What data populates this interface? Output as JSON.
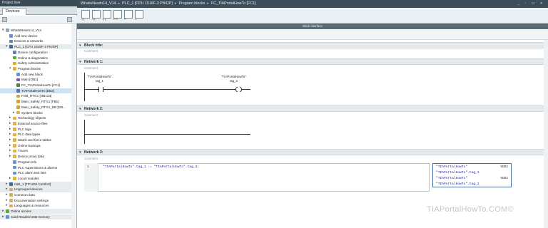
{
  "left_panel": {
    "title": "Project tree",
    "tab": "Devices",
    "tree": [
      {
        "label": "WhatisNewIn14_V14",
        "indent": 0,
        "icon_color": "#8aa7c0",
        "twisty": "▾"
      },
      {
        "label": "Add new device",
        "indent": 1,
        "icon_color": "#6a93c9",
        "twisty": ""
      },
      {
        "label": "Devices & networks",
        "indent": 1,
        "icon_color": "#5b86b8",
        "twisty": ""
      },
      {
        "label": "PLC_1 [CPU 1516F-3 PN/DP]",
        "indent": 1,
        "icon_color": "#3d6b9c",
        "twisty": "▾",
        "style": "grp"
      },
      {
        "label": "Device configuration",
        "indent": 2,
        "icon_color": "#5b86b8",
        "twisty": ""
      },
      {
        "label": "Online & diagnostics",
        "indent": 2,
        "icon_color": "#6aa04a",
        "twisty": ""
      },
      {
        "label": "Safety Administration",
        "indent": 2,
        "icon_color": "#e0b020",
        "twisty": ""
      },
      {
        "label": "Program blocks",
        "indent": 2,
        "icon_color": "#d9b24a",
        "twisty": "▾"
      },
      {
        "label": "Add new block",
        "indent": 3,
        "icon_color": "#6a93c9",
        "twisty": ""
      },
      {
        "label": "Main [OB1]",
        "indent": 3,
        "icon_color": "#8a4fb5",
        "twisty": ""
      },
      {
        "label": "FC_TIAPortalHowTo [FC1]",
        "indent": 3,
        "icon_color": "#3f8f3f",
        "twisty": ""
      },
      {
        "label": "TIAPortalHowTo [DB2]",
        "indent": 3,
        "icon_color": "#4f79b0",
        "twisty": "",
        "style": "sel"
      },
      {
        "label": "FOB_RTG1 [OB123]",
        "indent": 3,
        "icon_color": "#d9a02b",
        "twisty": ""
      },
      {
        "label": "Main_Safety_RTG1 [FB1]",
        "indent": 3,
        "icon_color": "#d9a02b",
        "twisty": ""
      },
      {
        "label": "Main_Safety_RTG1_DB [DB...",
        "indent": 3,
        "icon_color": "#d9a02b",
        "twisty": ""
      },
      {
        "label": "System blocks",
        "indent": 3,
        "icon_color": "#d9b24a",
        "twisty": "▸"
      },
      {
        "label": "Technology objects",
        "indent": 2,
        "icon_color": "#d9b24a",
        "twisty": "▸"
      },
      {
        "label": "External source files",
        "indent": 2,
        "icon_color": "#d9b24a",
        "twisty": "▸"
      },
      {
        "label": "PLC tags",
        "indent": 2,
        "icon_color": "#d9b24a",
        "twisty": "▸"
      },
      {
        "label": "PLC data types",
        "indent": 2,
        "icon_color": "#d9b24a",
        "twisty": "▸"
      },
      {
        "label": "Watch and force tables",
        "indent": 2,
        "icon_color": "#d9b24a",
        "twisty": "▸"
      },
      {
        "label": "Online backups",
        "indent": 2,
        "icon_color": "#d9b24a",
        "twisty": "▸"
      },
      {
        "label": "Traces",
        "indent": 2,
        "icon_color": "#d9b24a",
        "twisty": "▸"
      },
      {
        "label": "Device proxy data",
        "indent": 2,
        "icon_color": "#d9b24a",
        "twisty": "▸"
      },
      {
        "label": "Program info",
        "indent": 2,
        "icon_color": "#6a93c9",
        "twisty": ""
      },
      {
        "label": "PLC supervisions & alarms",
        "indent": 2,
        "icon_color": "#6a93c9",
        "twisty": ""
      },
      {
        "label": "PLC alarm text lists",
        "indent": 2,
        "icon_color": "#6a93c9",
        "twisty": ""
      },
      {
        "label": "Local modules",
        "indent": 2,
        "icon_color": "#d9b24a",
        "twisty": "▸"
      },
      {
        "label": "HMI_1 [TP1200 Comfort]",
        "indent": 1,
        "icon_color": "#3d6b9c",
        "twisty": "▸",
        "style": "grp"
      },
      {
        "label": "Ungrouped devices",
        "indent": 1,
        "icon_color": "#d9b24a",
        "twisty": "▸",
        "style": "grp"
      },
      {
        "label": "Common data",
        "indent": 1,
        "icon_color": "#d9b24a",
        "twisty": "▸"
      },
      {
        "label": "Documentation settings",
        "indent": 1,
        "icon_color": "#d9b24a",
        "twisty": "▸"
      },
      {
        "label": "Languages & resources",
        "indent": 1,
        "icon_color": "#d9b24a",
        "twisty": "▸"
      },
      {
        "label": "Online access",
        "indent": 0,
        "icon_color": "#6aa04a",
        "twisty": "▸",
        "style": "grp"
      },
      {
        "label": "Card Reader/USB memory",
        "indent": 0,
        "icon_color": "#6a93c9",
        "twisty": "▸",
        "style": "grp"
      }
    ]
  },
  "breadcrumb": {
    "items": [
      "WhatisNewIn14_V14",
      "PLC_1 [CPU 1516F-3 PN/DP]",
      "Program blocks",
      "FC_TIAPortalHowTo [FC1]"
    ]
  },
  "toolbar": {
    "block_interface": "Block interface",
    "ladder_buttons": [
      "-| |-",
      "-|/|-",
      "-( )-",
      "⊢??",
      "↦",
      "↪"
    ]
  },
  "editor": {
    "block_title": "Block title:",
    "block_comment": "Comment",
    "networks": [
      {
        "title": "Network 1:",
        "comment": "Comment"
      },
      {
        "title": "Network 2:",
        "comment": "Comment"
      },
      {
        "title": "Network 3:",
        "comment": "Comment"
      }
    ],
    "network1": {
      "contact_db": "\"TIAPortalHowTo\".",
      "contact_tag": "tag_1",
      "coil_db": "\"TIAPortalHowTo\".",
      "coil_tag": "tag_2"
    },
    "scl": {
      "line_number": "1",
      "code": "\"TIAPortalHowTo\".tag_1 := \"TIAPortalHowTo\".tag_2;"
    },
    "autocomplete": [
      {
        "text": "\"TIAPortalHowTo\"",
        "addr": "%DB2"
      },
      {
        "text": "\"TIAPortalHowTo\".tag_1",
        "addr": ""
      },
      {
        "text": "\"TIAPortalHowTo\"",
        "addr": "%DB2"
      },
      {
        "text": "\"TIAPortalHowTo\".tag_2",
        "addr": ""
      }
    ]
  },
  "watermark": "TIAPortalHowTo.COM©"
}
